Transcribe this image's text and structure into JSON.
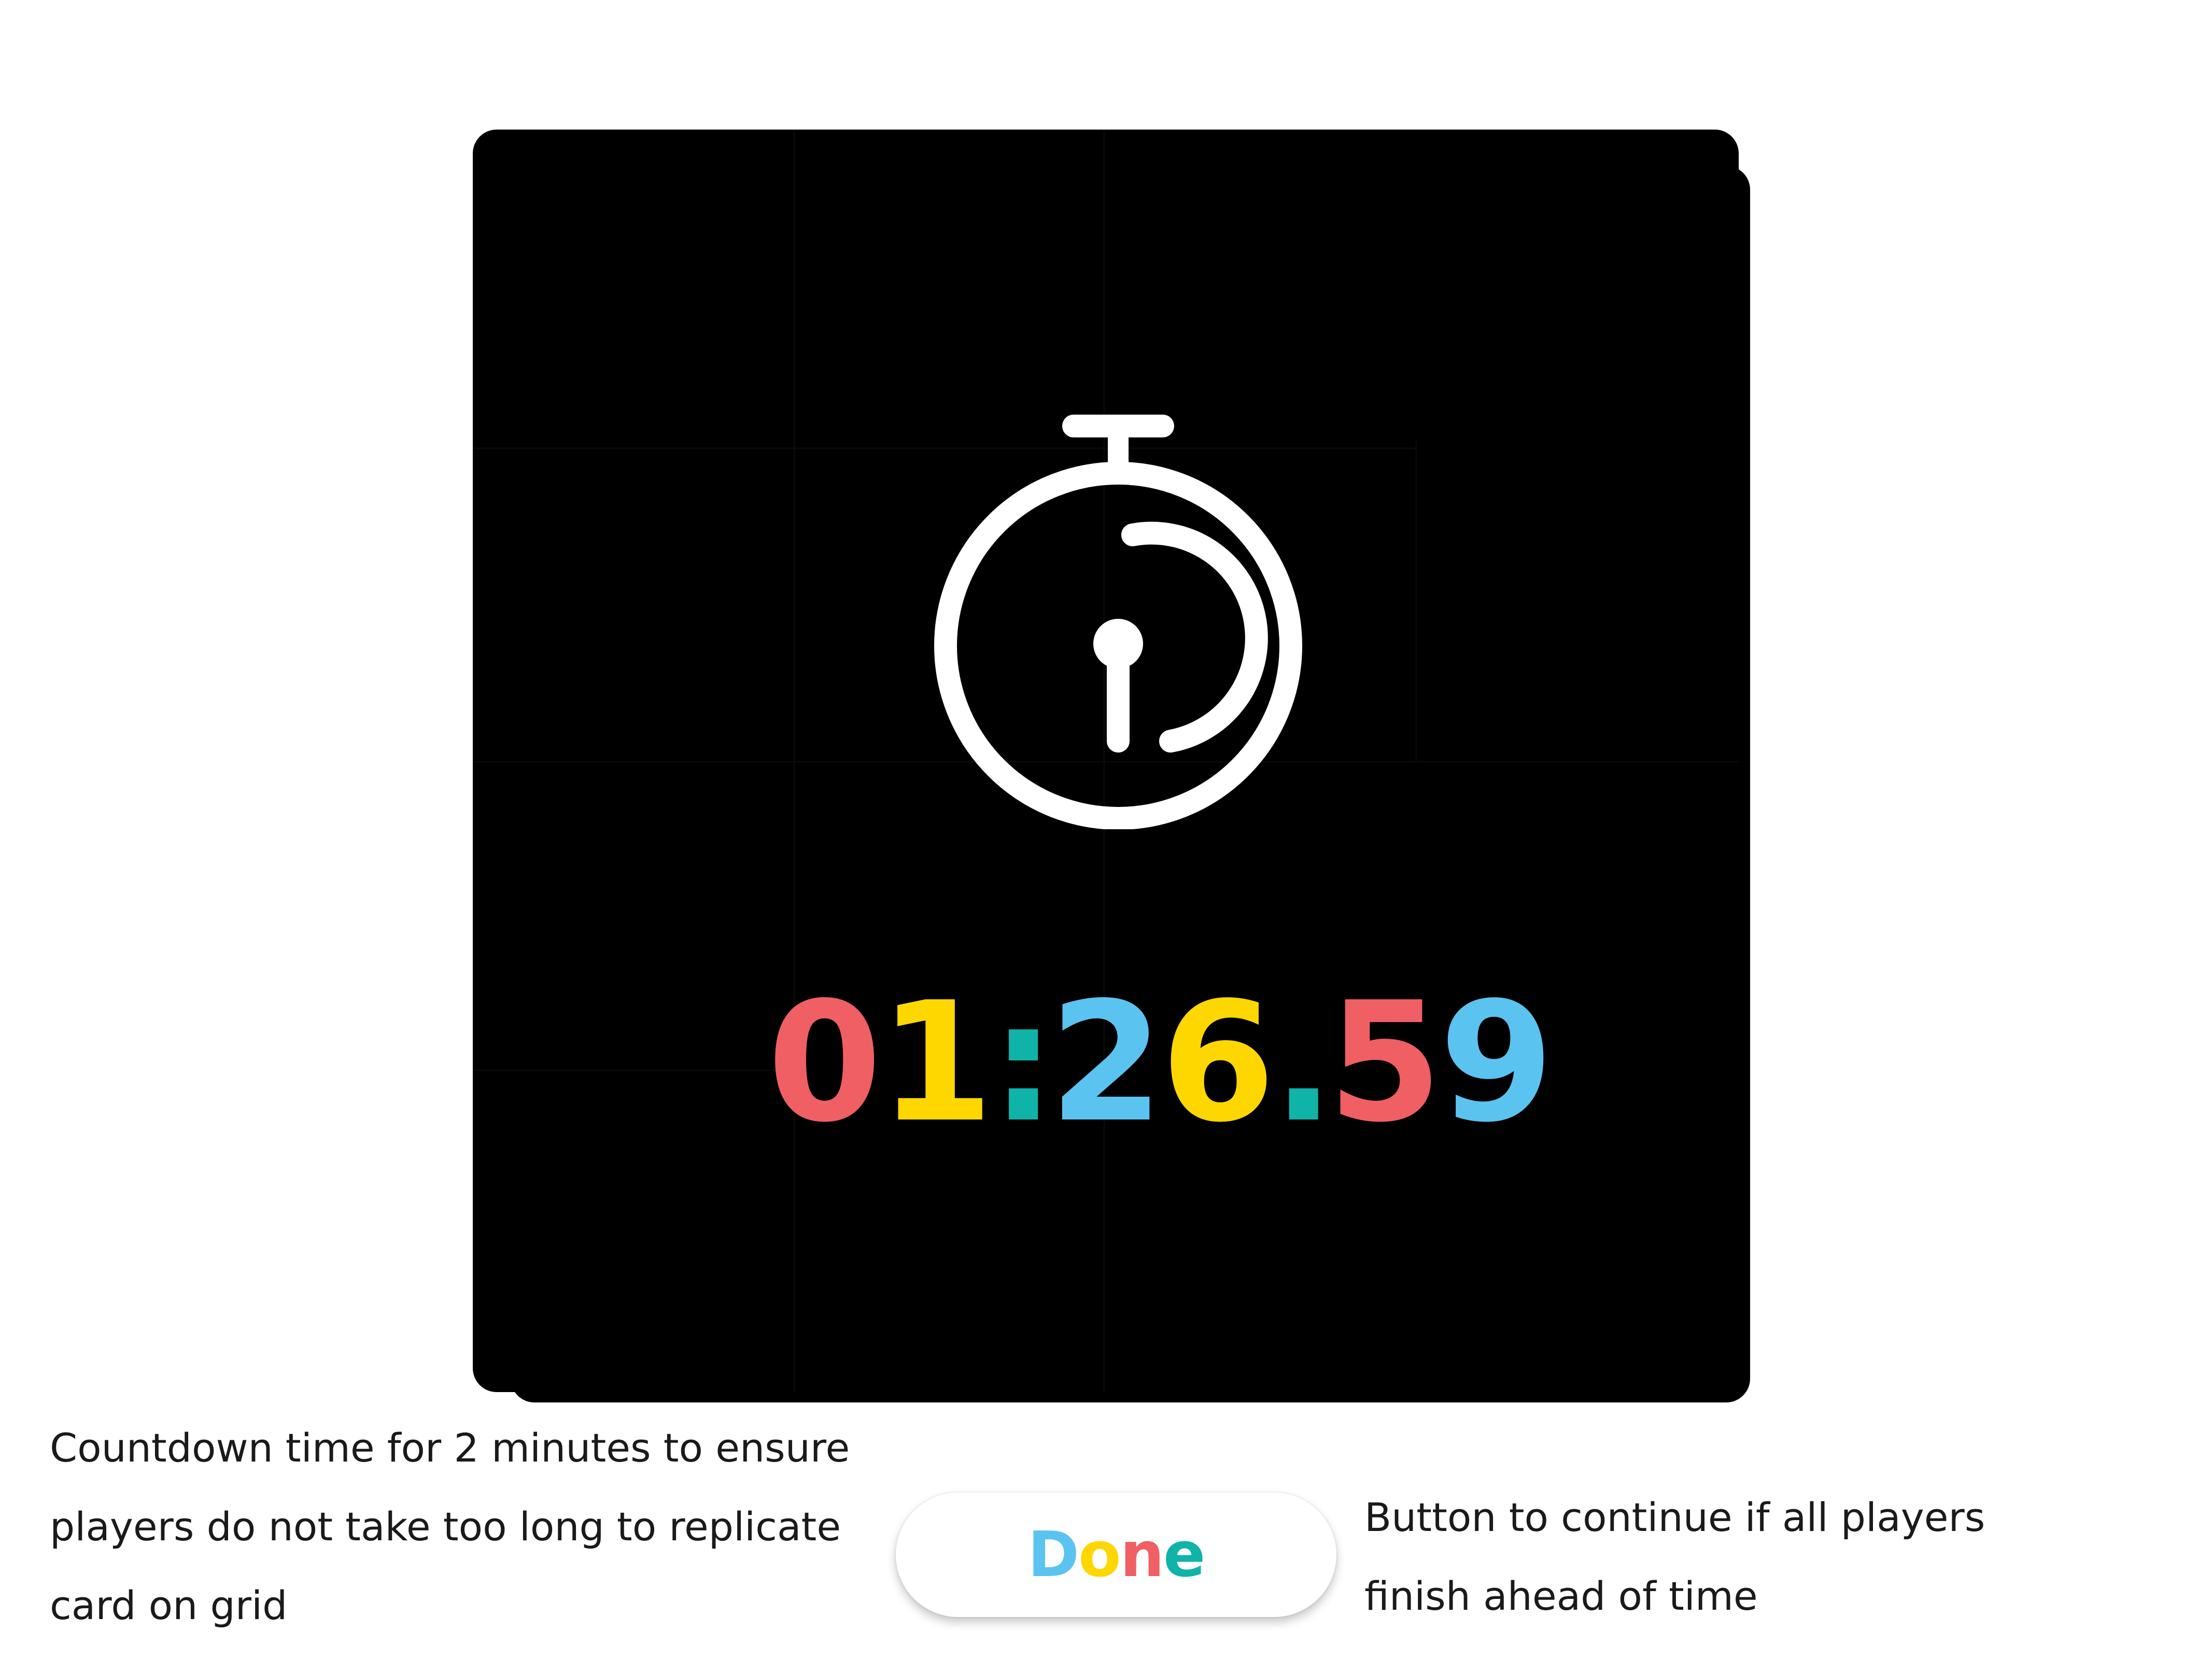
{
  "timer": {
    "digits": [
      {
        "text": "0",
        "color": "#EF5F63"
      },
      {
        "text": "1",
        "color": "#FFD700"
      },
      {
        "text": ":",
        "color": "#0FB3A8"
      },
      {
        "text": "2",
        "color": "#5BC3F0"
      },
      {
        "text": "6",
        "color": "#FFD700"
      },
      {
        "text": ".",
        "color": "#0FB3A8"
      },
      {
        "text": "5",
        "color": "#EF5F63"
      },
      {
        "text": "9",
        "color": "#5BC3F0"
      }
    ],
    "icon": "stopwatch-icon"
  },
  "done_button": {
    "letters": [
      {
        "text": "D",
        "color": "#5BC3F0"
      },
      {
        "text": "o",
        "color": "#FFD700"
      },
      {
        "text": "n",
        "color": "#EF5F63"
      },
      {
        "text": "e",
        "color": "#0FB3A8"
      }
    ]
  },
  "annotations": {
    "left": [
      "Countdown time for 2 minutes to ensure",
      "players do not take too long to replicate",
      "card on grid"
    ],
    "right": [
      "Button to continue if all players",
      "finish ahead of time"
    ]
  },
  "colors": {
    "card_background": "#000000",
    "page_background": "#FFFFFF",
    "icon_stroke": "#FFFFFF"
  }
}
